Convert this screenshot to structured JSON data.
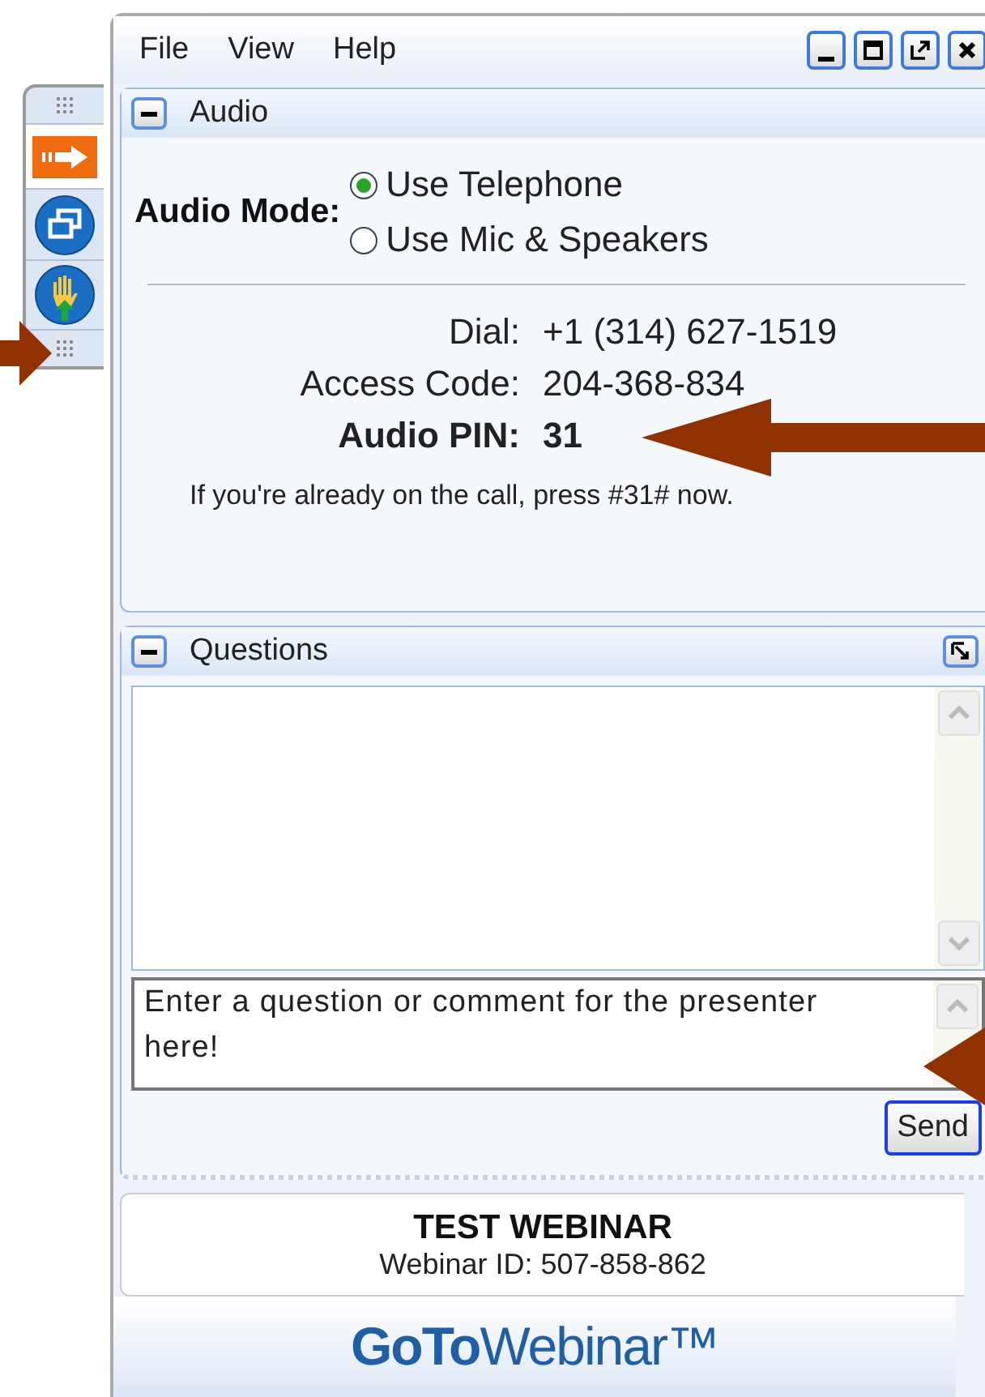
{
  "toolbar": {
    "buttons": [
      {
        "kind": "arrow",
        "selected": true
      },
      {
        "kind": "windows",
        "selected": false
      },
      {
        "kind": "raise-hand",
        "selected": false
      }
    ]
  },
  "menu": [
    "File",
    "View",
    "Help"
  ],
  "audio": {
    "title": "Audio",
    "expanded": true,
    "mode_label": "Audio Mode:",
    "options": [
      {
        "label": "Use Telephone",
        "selected": true
      },
      {
        "label": "Use Mic & Speakers",
        "selected": false
      }
    ],
    "details": [
      {
        "label": "Dial:",
        "value": "+1 (314) 627-1519",
        "kind": "plain"
      },
      {
        "label": "Access Code:",
        "value": "204-368-834",
        "kind": "plain"
      },
      {
        "label": "Audio PIN:",
        "value": "31",
        "kind": "emphasis"
      }
    ],
    "note": "If you're already on the call, press #31# now."
  },
  "questions": {
    "title": "Questions",
    "expanded": true,
    "placeholder": "Enter a question or comment for the presenter here!",
    "send": "Send"
  },
  "footer": {
    "title": "TEST WEBINAR",
    "webinar_id": "Webinar ID: 507-858-862",
    "logo": "**GoTo**Webinar™"
  }
}
